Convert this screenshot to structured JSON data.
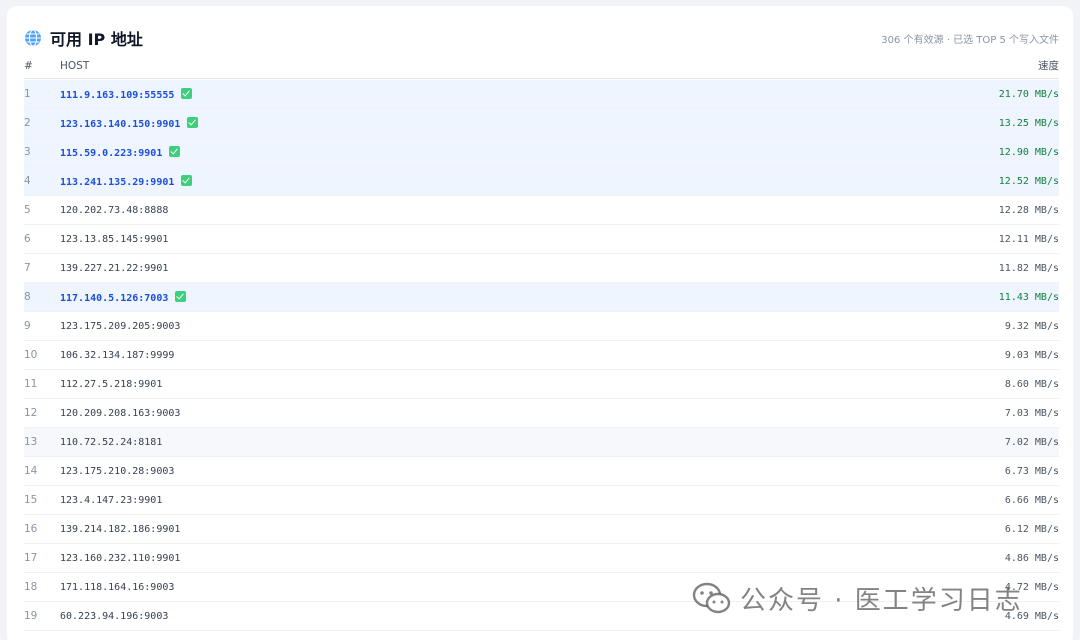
{
  "header": {
    "title": "可用 IP 地址",
    "summary": "306 个有效源 · 已选 TOP 5 个写入文件",
    "icon": "globe-icon"
  },
  "columns": {
    "num": "#",
    "host": "HOST",
    "speed": "速度"
  },
  "rows": [
    {
      "num": "1",
      "host": "111.9.163.109:55555",
      "speed": "21.70 MB/s",
      "selected": true
    },
    {
      "num": "2",
      "host": "123.163.140.150:9901",
      "speed": "13.25 MB/s",
      "selected": true
    },
    {
      "num": "3",
      "host": "115.59.0.223:9901",
      "speed": "12.90 MB/s",
      "selected": true
    },
    {
      "num": "4",
      "host": "113.241.135.29:9901",
      "speed": "12.52 MB/s",
      "selected": true
    },
    {
      "num": "5",
      "host": "120.202.73.48:8888",
      "speed": "12.28 MB/s",
      "selected": false
    },
    {
      "num": "6",
      "host": "123.13.85.145:9901",
      "speed": "12.11 MB/s",
      "selected": false
    },
    {
      "num": "7",
      "host": "139.227.21.22:9901",
      "speed": "11.82 MB/s",
      "selected": false
    },
    {
      "num": "8",
      "host": "117.140.5.126:7003",
      "speed": "11.43 MB/s",
      "selected": true
    },
    {
      "num": "9",
      "host": "123.175.209.205:9003",
      "speed": "9.32 MB/s",
      "selected": false
    },
    {
      "num": "10",
      "host": "106.32.134.187:9999",
      "speed": "9.03 MB/s",
      "selected": false
    },
    {
      "num": "11",
      "host": "112.27.5.218:9901",
      "speed": "8.60 MB/s",
      "selected": false
    },
    {
      "num": "12",
      "host": "120.209.208.163:9003",
      "speed": "7.03 MB/s",
      "selected": false
    },
    {
      "num": "13",
      "host": "110.72.52.24:8181",
      "speed": "7.02 MB/s",
      "selected": false,
      "hover": true
    },
    {
      "num": "14",
      "host": "123.175.210.28:9003",
      "speed": "6.73 MB/s",
      "selected": false
    },
    {
      "num": "15",
      "host": "123.4.147.23:9901",
      "speed": "6.66 MB/s",
      "selected": false
    },
    {
      "num": "16",
      "host": "139.214.182.186:9901",
      "speed": "6.12 MB/s",
      "selected": false
    },
    {
      "num": "17",
      "host": "123.160.232.110:9901",
      "speed": "4.86 MB/s",
      "selected": false
    },
    {
      "num": "18",
      "host": "171.118.164.16:9003",
      "speed": "4.72 MB/s",
      "selected": false
    },
    {
      "num": "19",
      "host": "60.223.94.196:9003",
      "speed": "4.69 MB/s",
      "selected": false
    }
  ],
  "watermark": {
    "text": "公众号 · 医工学习日志"
  },
  "colors": {
    "selected_bg": "#eef5ff",
    "selected_host": "#1d4ed8",
    "selected_speed": "#15803d",
    "check": "#3ecf7c"
  }
}
